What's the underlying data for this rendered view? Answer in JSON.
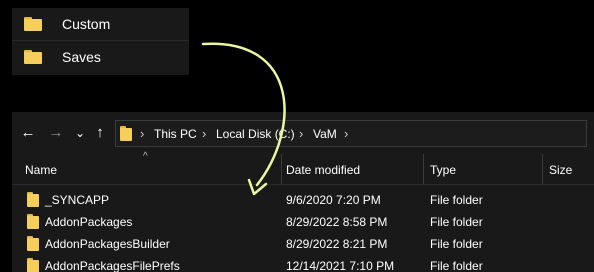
{
  "top_panel": {
    "items": [
      {
        "label": "Custom",
        "icon": "folder-icon"
      },
      {
        "label": "Saves",
        "icon": "folder-icon"
      }
    ]
  },
  "annotation": {
    "color": "#e9f7a1",
    "icon": "curved-arrow-icon"
  },
  "explorer": {
    "nav": {
      "back": "←",
      "forward": "→",
      "recent": "⌄",
      "up": "↑"
    },
    "breadcrumb": [
      "This PC",
      "Local Disk (C:)",
      "VaM"
    ],
    "columns": [
      "Name",
      "Date modified",
      "Type",
      "Size"
    ],
    "rows": [
      {
        "name": "_SYNCAPP",
        "date": "9/6/2020 7:20 PM",
        "type": "File folder"
      },
      {
        "name": "AddonPackages",
        "date": "8/29/2022 8:58 PM",
        "type": "File folder"
      },
      {
        "name": "AddonPackagesBuilder",
        "date": "8/29/2022 8:21 PM",
        "type": "File folder"
      },
      {
        "name": "AddonPackagesFilePrefs",
        "date": "12/14/2021 7:10 PM",
        "type": "File folder"
      }
    ]
  },
  "colors": {
    "folder": "#f6cf5a",
    "folder_tab": "#e7b83e",
    "panel_bg": "#191919"
  }
}
